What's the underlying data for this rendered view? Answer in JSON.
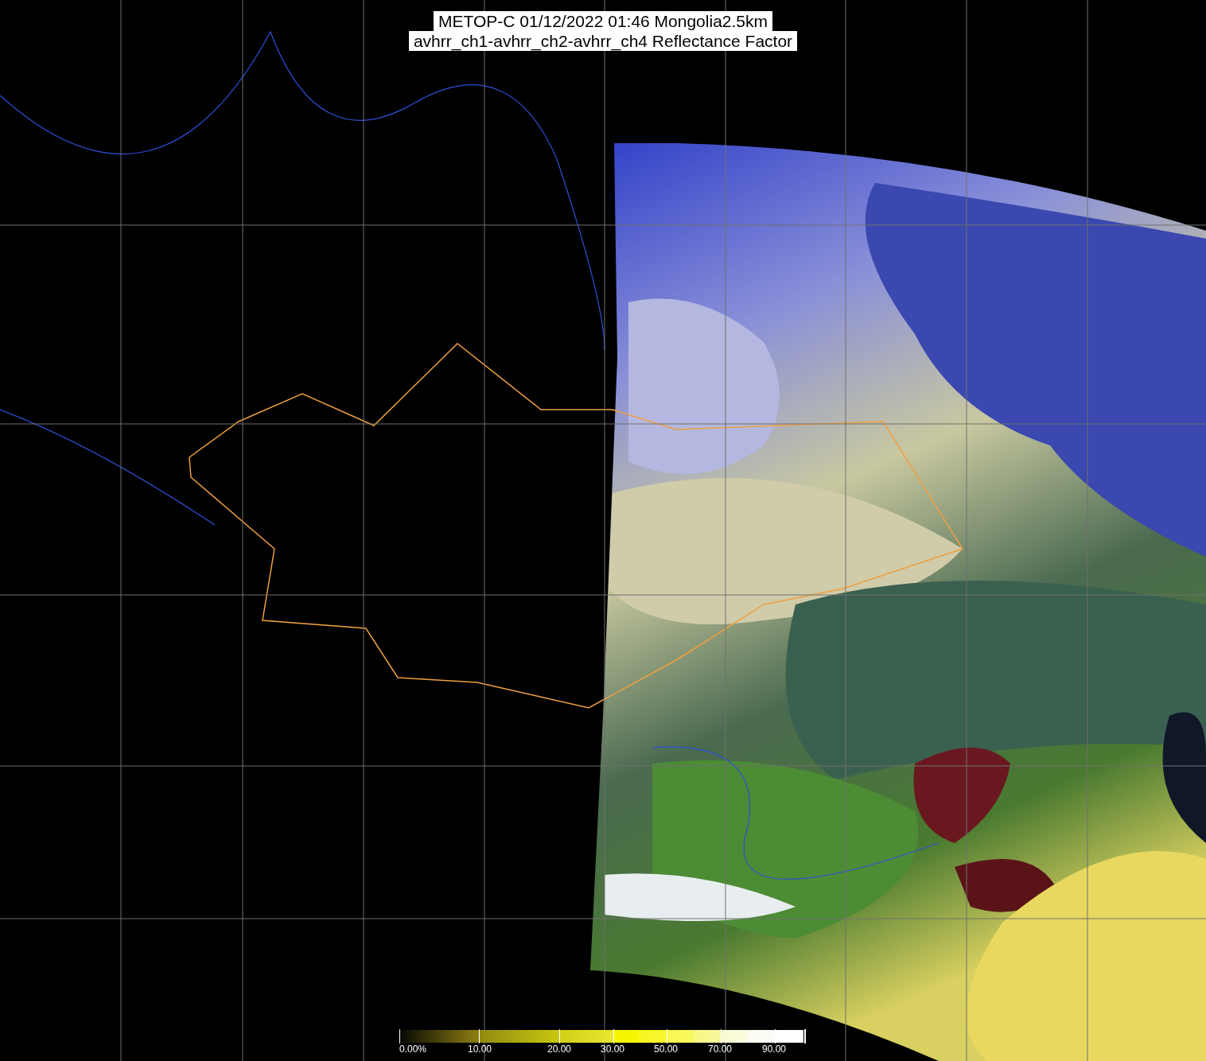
{
  "title": {
    "line_1": "METOP-C 01/12/2022 01:46 Mongolia2.5km",
    "line_2": "avhrr_ch1-avhrr_ch2-avhrr_ch4 Reflectance Factor"
  },
  "colorbar": {
    "labels": [
      "0.00%",
      "10.00",
      "20.00",
      "30.00",
      "50.00",
      "70.00",
      "90.00"
    ]
  }
}
